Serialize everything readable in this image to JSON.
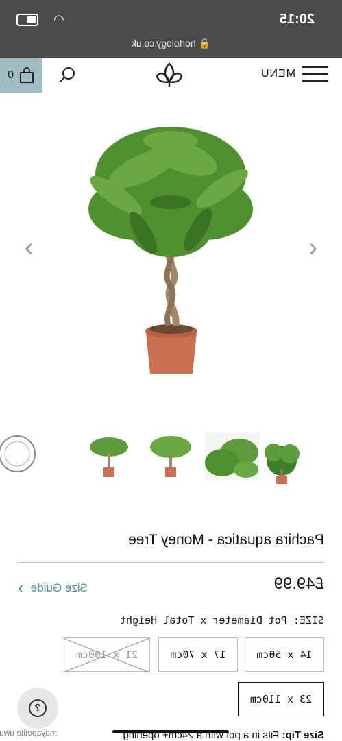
{
  "status_bar": {
    "time": "20:15",
    "url": "hortology.co.uk"
  },
  "header": {
    "menu_label": "MENU",
    "cart_count": "0"
  },
  "gallery": {
    "prev_symbol": "‹",
    "next_symbol": "›"
  },
  "product": {
    "title": "Pachira aquatica - Money Tree",
    "price": "£49.99",
    "size_guide_label": "Size Guide",
    "size_label": "SIZE: Pot Diameter x Total Height",
    "sizes": [
      {
        "label": "14 x 50cm",
        "available": true
      },
      {
        "label": "17 x 70cm",
        "available": true
      },
      {
        "label": "21 x 100cm",
        "available": false
      },
      {
        "label": "23 x 110cm",
        "available": true,
        "selected": true
      }
    ],
    "tip_label": "Size Tip:",
    "tip_text": " Fits in a pot with a 24cm+ opening"
  },
  "watermark": "mayapetite uwu",
  "colors": {
    "status_bar": "#4b4b4b",
    "cart_bg": "#9fbdc3",
    "accent": "#4f8c93"
  }
}
